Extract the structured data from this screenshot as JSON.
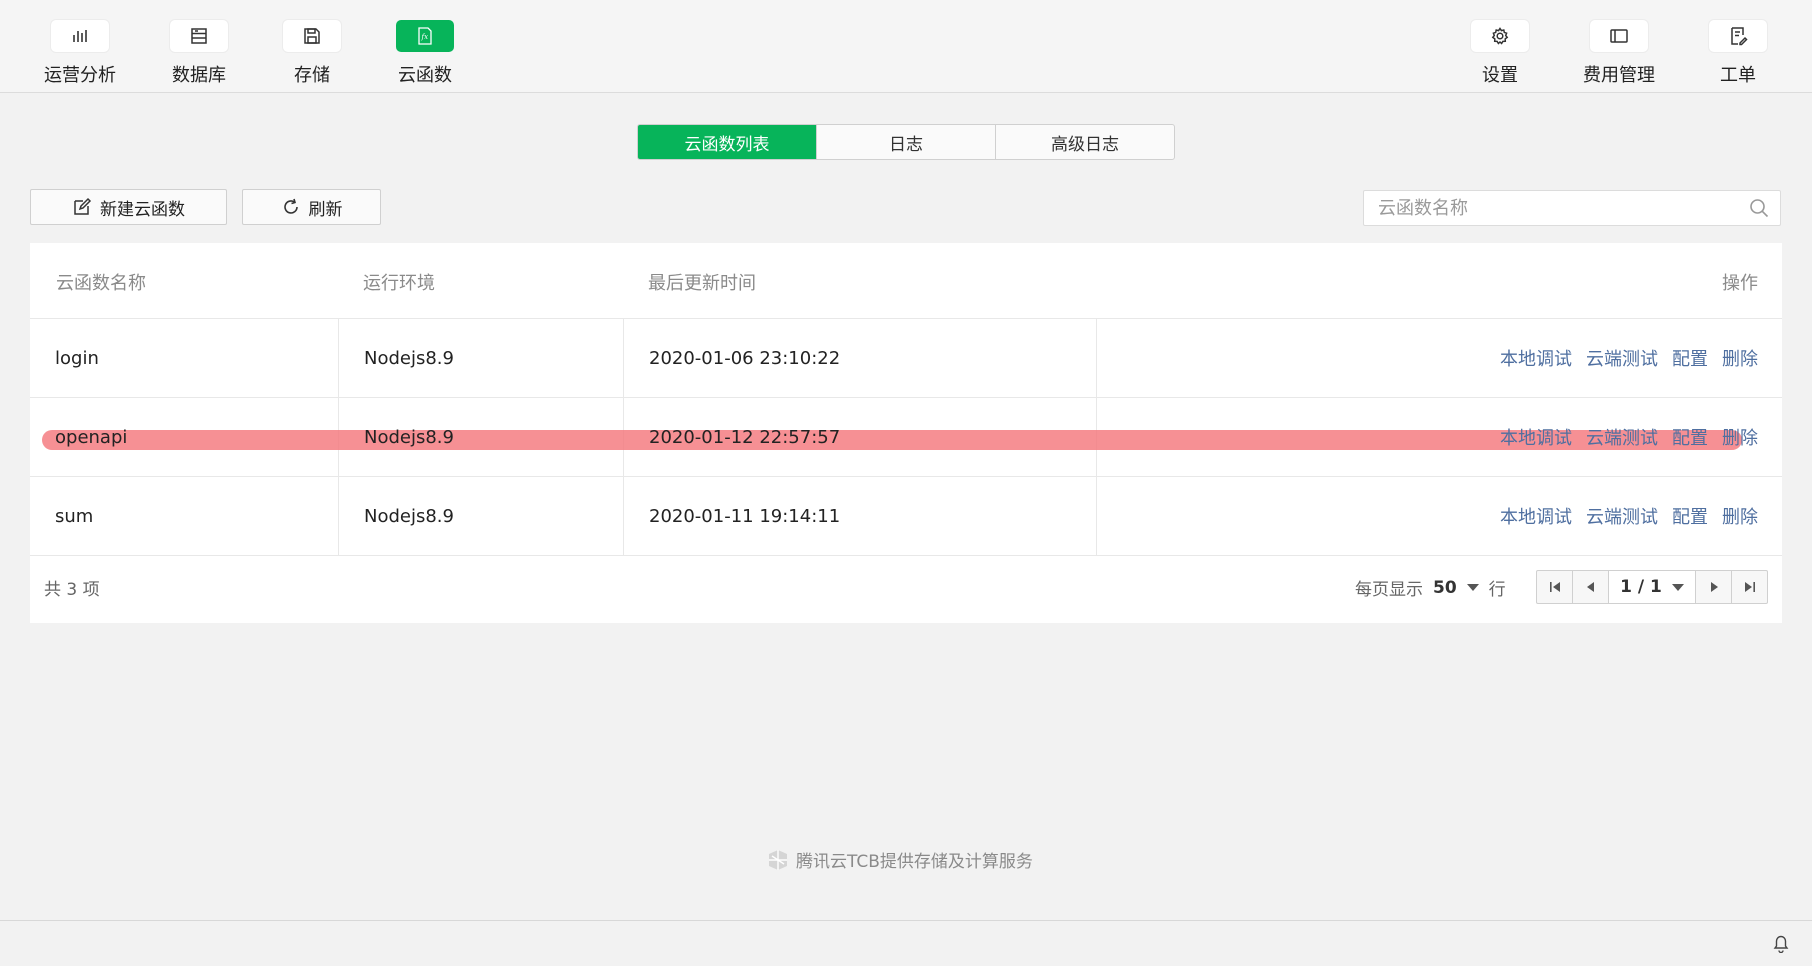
{
  "toolbar": {
    "left": [
      {
        "label": "运营分析",
        "icon": "bar-chart-icon"
      },
      {
        "label": "数据库",
        "icon": "database-icon"
      },
      {
        "label": "存储",
        "icon": "storage-icon"
      },
      {
        "label": "云函数",
        "icon": "fx-icon",
        "active": true
      }
    ],
    "right": [
      {
        "label": "设置",
        "icon": "gear-icon"
      },
      {
        "label": "费用管理",
        "icon": "billing-icon"
      },
      {
        "label": "工单",
        "icon": "ticket-icon"
      }
    ]
  },
  "tabs": [
    {
      "label": "云函数列表",
      "active": true
    },
    {
      "label": "日志"
    },
    {
      "label": "高级日志"
    }
  ],
  "actions": {
    "new_label": "新建云函数",
    "refresh_label": "刷新",
    "search_placeholder": "云函数名称"
  },
  "table": {
    "columns": [
      "云函数名称",
      "运行环境",
      "最后更新时间",
      "操作"
    ],
    "rows": [
      {
        "name": "login",
        "env": "Nodejs8.9",
        "updated": "2020-01-06 23:10:22"
      },
      {
        "name": "openapi",
        "env": "Nodejs8.9",
        "updated": "2020-01-12 22:57:57",
        "highlighted": true
      },
      {
        "name": "sum",
        "env": "Nodejs8.9",
        "updated": "2020-01-11 19:14:11"
      }
    ],
    "ops": [
      "本地调试",
      "云端测试",
      "配置",
      "删除"
    ]
  },
  "pagination": {
    "total_text": "共 3 项",
    "per_page_label": "每页显示",
    "per_page_value": "50",
    "per_page_unit": "行",
    "page_text": "1 / 1"
  },
  "footer": {
    "brand_text": "腾讯云TCB提供存储及计算服务"
  },
  "colors": {
    "accent": "#07b45a",
    "link": "#4f6fa0",
    "highlight": "#f4777d"
  }
}
